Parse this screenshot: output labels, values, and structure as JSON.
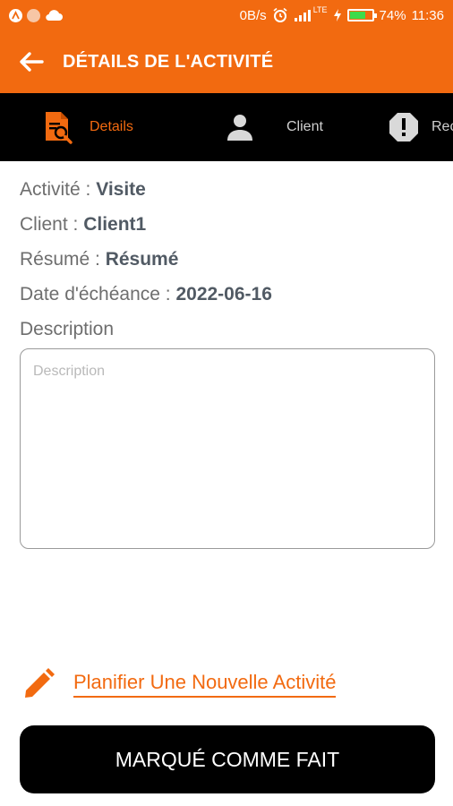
{
  "status_bar": {
    "speed": "0B/s",
    "network": "LTE",
    "battery_percent": "74%",
    "battery_level": 0.74,
    "time": "11:36",
    "icons": [
      "app-notification-icon",
      "notification-dot-icon",
      "cloud-icon",
      "alarm-icon",
      "signal-icon",
      "charging-icon",
      "battery-icon"
    ]
  },
  "app_bar": {
    "title": "DÉTAILS DE L'ACTIVITÉ",
    "back_icon": "arrow-left-icon"
  },
  "tabs": [
    {
      "label": "Details",
      "icon": "document-search-icon",
      "active": true
    },
    {
      "label": "Client",
      "icon": "person-icon",
      "active": false
    },
    {
      "label": "Rec",
      "icon": "alert-circle-icon",
      "active": false
    }
  ],
  "details": {
    "activite_label": "Activité : ",
    "activite_value": "Visite",
    "client_label": "Client : ",
    "client_value": "Client1",
    "resume_label": "Résumé : ",
    "resume_value": "Résumé",
    "date_label": "Date d'échéance : ",
    "date_value": "2022-06-16",
    "description_label": "Description"
  },
  "description_field": {
    "placeholder": "Description",
    "value": ""
  },
  "plan_link": {
    "label": "Planifier Une Nouvelle Activité",
    "icon": "pencil-icon"
  },
  "done_button": {
    "label": "MARQUÉ COMME FAIT"
  },
  "colors": {
    "accent": "#f26a10",
    "tab_bar": "#000000",
    "button": "#000000"
  }
}
